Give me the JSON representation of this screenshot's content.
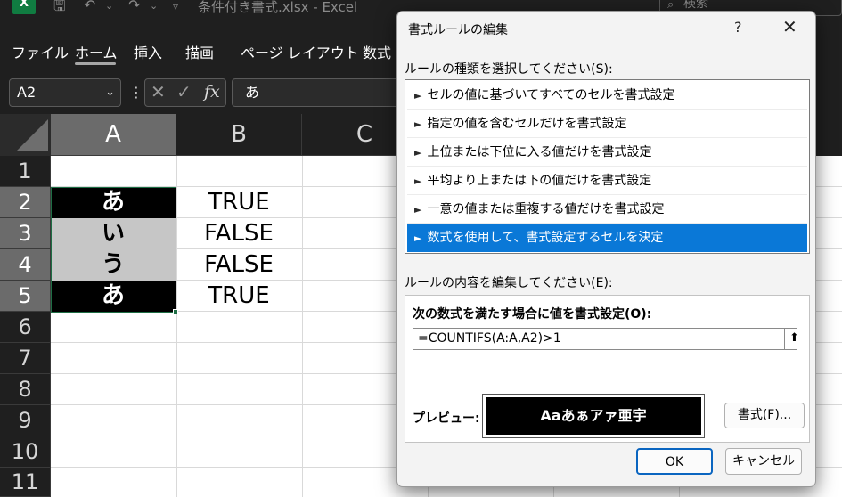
{
  "window": {
    "title": "条件付き書式.xlsx  -  Excel",
    "search_placeholder": "検索",
    "app_logo": "X"
  },
  "ribbon": {
    "tabs": [
      {
        "label": "ファイル"
      },
      {
        "label": "ホーム",
        "active": true
      },
      {
        "label": "挿入"
      },
      {
        "label": "描画"
      },
      {
        "label": "ページ レイアウト"
      },
      {
        "label": "数式"
      }
    ]
  },
  "formula_bar": {
    "name_box": "A2",
    "cancel_icon": "close-icon",
    "enter_icon": "check-icon",
    "function_label": "fx",
    "content": "あ"
  },
  "grid": {
    "columns": [
      "A",
      "B",
      "C"
    ],
    "rows": [
      "1",
      "2",
      "3",
      "4",
      "5",
      "6",
      "7",
      "8",
      "9",
      "10",
      "11"
    ],
    "selected_column": "A",
    "selected_rows": [
      "2",
      "3",
      "4",
      "5"
    ],
    "cells": [
      {
        "row": "2",
        "a": "あ",
        "a_fill": "#000000",
        "b": "TRUE"
      },
      {
        "row": "3",
        "a": "い",
        "a_fill": "#c6c6c6",
        "b": "FALSE"
      },
      {
        "row": "4",
        "a": "う",
        "a_fill": "#c6c6c6",
        "b": "FALSE"
      },
      {
        "row": "5",
        "a": "あ",
        "a_fill": "#000000",
        "b": "TRUE"
      }
    ]
  },
  "dialog": {
    "title": "書式ルールの編集",
    "help": "?",
    "close": "✕",
    "rule_type_label": "ルールの種類を選択してください(S):",
    "rule_types": [
      {
        "label": "セルの値に基づいてすべてのセルを書式設定",
        "selected": false
      },
      {
        "label": "指定の値を含むセルだけを書式設定",
        "selected": false
      },
      {
        "label": "上位または下位に入る値だけを書式設定",
        "selected": false
      },
      {
        "label": "平均より上または下の値だけを書式設定",
        "selected": false
      },
      {
        "label": "一意の値または重複する値だけを書式設定",
        "selected": false
      },
      {
        "label": "数式を使用して、書式設定するセルを決定",
        "selected": true
      }
    ],
    "edit_label": "ルールの内容を編集してください(E):",
    "condition_label": "次の数式を満たす場合に値を書式設定(O):",
    "formula": "=COUNTIFS(A:A,A2)>1",
    "preview_label": "プレビュー:",
    "preview_sample": "Aaあぁアァ亜宇",
    "format_button": "書式(F)...",
    "ok": "OK",
    "cancel": "キャンセル",
    "accent_color": "#0a78d7"
  }
}
